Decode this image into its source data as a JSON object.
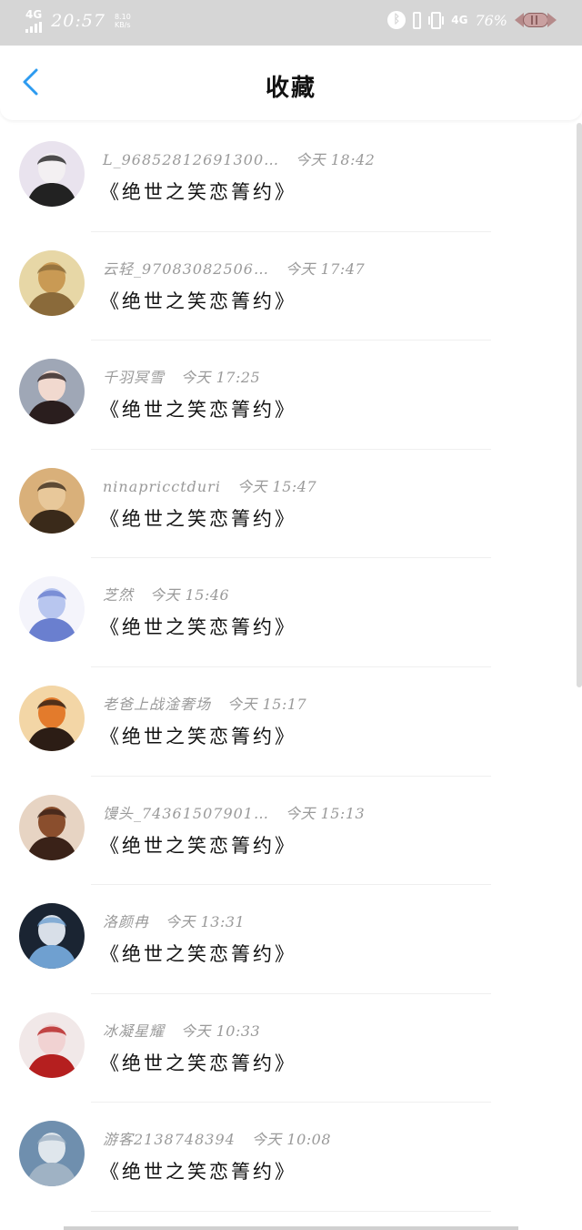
{
  "status_bar": {
    "network_left": "4G",
    "time": "20:57",
    "speed_value": "8.10",
    "speed_unit": "KB/s",
    "bluetooth_icon": "bluetooth-icon",
    "network_right": "4G",
    "battery_percent": "76%"
  },
  "header": {
    "back_icon": "chevron-left-icon",
    "title": "收藏",
    "accent_color": "#2d9bf0"
  },
  "favorites": [
    {
      "name": "L_96852812691300…",
      "time": "今天 18:42",
      "content": "《绝世之笑恋箐约》",
      "avatar": {
        "bg": "#e9e3ee",
        "fg": "#f3f0f2",
        "accent": "#222222"
      }
    },
    {
      "name": "云轻_97083082506…",
      "time": "今天 17:47",
      "content": "《绝世之笑恋箐约》",
      "avatar": {
        "bg": "#e7d7a6",
        "fg": "#c99a54",
        "accent": "#8a6a3a"
      }
    },
    {
      "name": "千羽冥雪",
      "time": "今天 17:25",
      "content": "《绝世之笑恋箐约》",
      "avatar": {
        "bg": "#9fa7b6",
        "fg": "#f1d9cf",
        "accent": "#2a1e1e"
      }
    },
    {
      "name": "ninapricctduri",
      "time": "今天 15:47",
      "content": "《绝世之笑恋箐约》",
      "avatar": {
        "bg": "#d9b07a",
        "fg": "#e8c89a",
        "accent": "#3a2a1a"
      }
    },
    {
      "name": "芝然",
      "time": "今天 15:46",
      "content": "《绝世之笑恋箐约》",
      "avatar": {
        "bg": "#f4f4fb",
        "fg": "#b8c6ef",
        "accent": "#6a7fcf"
      }
    },
    {
      "name": "老爸上战淦奢场",
      "time": "今天 15:17",
      "content": "《绝世之笑恋箐约》",
      "avatar": {
        "bg": "#f3d6a6",
        "fg": "#e37b2c",
        "accent": "#2c1d15"
      }
    },
    {
      "name": "馒头_74361507901…",
      "time": "今天 15:13",
      "content": "《绝世之笑恋箐约》",
      "avatar": {
        "bg": "#e7d4c3",
        "fg": "#8a4e2d",
        "accent": "#3a2218"
      }
    },
    {
      "name": "洛颜冉",
      "time": "今天 13:31",
      "content": "《绝世之笑恋箐约》",
      "avatar": {
        "bg": "#1a2432",
        "fg": "#d8dfe8",
        "accent": "#6fa0d0"
      }
    },
    {
      "name": "冰凝星耀",
      "time": "今天 10:33",
      "content": "《绝世之笑恋箐约》",
      "avatar": {
        "bg": "#f1e8e8",
        "fg": "#f1d2d2",
        "accent": "#b51f1f"
      }
    },
    {
      "name": "游客2138748394",
      "time": "今天 10:08",
      "content": "《绝世之笑恋箐约》",
      "avatar": {
        "bg": "#6f8fae",
        "fg": "#dfe6ec",
        "accent": "#9fb2c4"
      }
    }
  ]
}
